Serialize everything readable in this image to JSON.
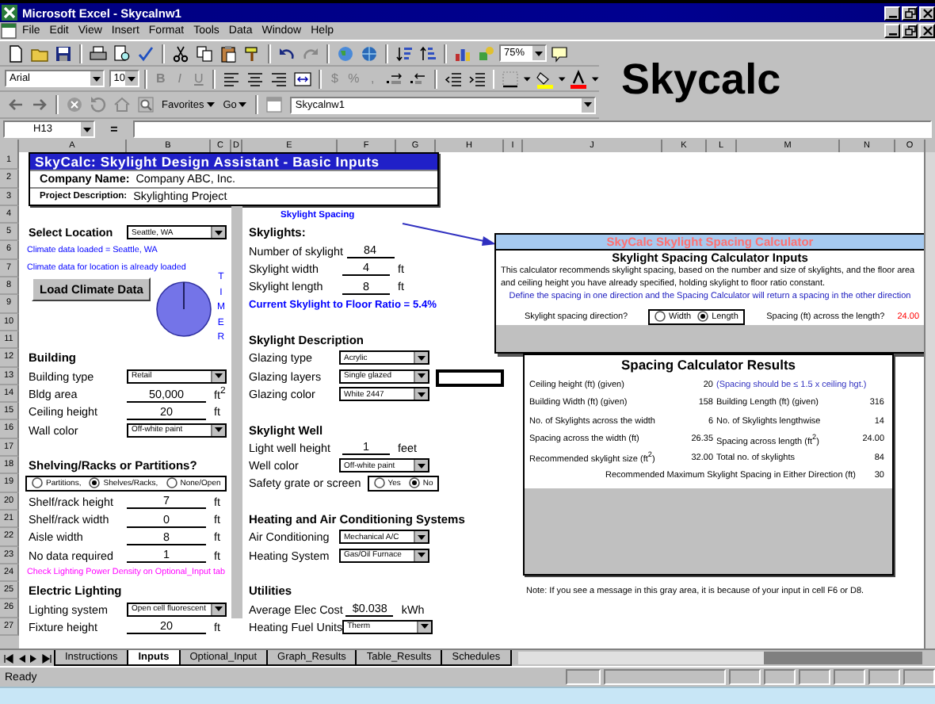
{
  "window": {
    "title": "Microsoft Excel - Skycalnw1"
  },
  "menu": [
    "File",
    "Edit",
    "View",
    "Insert",
    "Format",
    "Tools",
    "Data",
    "Window",
    "Help"
  ],
  "toolbar": {
    "zoom": "75%"
  },
  "formatting": {
    "font": "Arial",
    "size": "10",
    "styles": [
      "B",
      "I",
      "U"
    ],
    "number_formats": [
      "$",
      "%",
      ","
    ]
  },
  "web_toolbar": {
    "favorites": "Favorites",
    "go": "Go",
    "address": "Skycalnw1"
  },
  "banner": "Skycalc",
  "formula_bar": {
    "name_box": "H13",
    "equals": "="
  },
  "columns": [
    "A",
    "B",
    "C",
    "D",
    "E",
    "F",
    "G",
    "H",
    "I",
    "J",
    "K",
    "L",
    "M",
    "N",
    "O"
  ],
  "rows": [
    "1",
    "2",
    "3",
    "4",
    "5",
    "6",
    "7",
    "8",
    "9",
    "10",
    "11",
    "12",
    "13",
    "14",
    "15",
    "16",
    "17",
    "18",
    "19",
    "20",
    "21",
    "22",
    "23",
    "24",
    "25",
    "26",
    "27"
  ],
  "title_block": {
    "title": "SkyCalc: Skylight Design Assistant - Basic Inputs",
    "company_label": "Company Name:",
    "company": "Company ABC, Inc.",
    "project_label": "Project Description:",
    "project": "Skylighting Project"
  },
  "left_items": [
    {
      "kind": "blank"
    },
    {
      "kind": "selector",
      "label": "Select Location",
      "value": "Seattle, WA"
    },
    {
      "kind": "note",
      "text": "Climate data loaded = Seattle, WA",
      "color": "#0000ff"
    },
    {
      "kind": "note",
      "text": "Climate data for location is already loaded",
      "color": "#0000ff"
    },
    {
      "kind": "button",
      "label": "Load Climate Data"
    },
    {
      "kind": "blank"
    },
    {
      "kind": "blank"
    },
    {
      "kind": "heading",
      "label": "Building"
    },
    {
      "kind": "dropdown",
      "label": "Building type",
      "value": "Retail"
    },
    {
      "kind": "input",
      "label": "Bldg area",
      "value": "50,000",
      "unit": "ft$^{2}$"
    },
    {
      "kind": "input",
      "label": "Ceiling height",
      "value": "20",
      "unit": "ft"
    },
    {
      "kind": "dropdown",
      "label": "Wall color",
      "value": "Off-white paint"
    },
    {
      "kind": "blank"
    },
    {
      "kind": "heading",
      "label": "Shelving/Racks or Partitions?"
    },
    {
      "kind": "radio",
      "options": [
        {
          "label": "Partitions,",
          "selected": false
        },
        {
          "label": "Shelves/Racks,",
          "selected": true
        },
        {
          "label": "None/Open",
          "selected": false
        }
      ]
    },
    {
      "kind": "input",
      "label": "Shelf/rack height",
      "value": "7",
      "unit": "ft"
    },
    {
      "kind": "input",
      "label": "Shelf/rack width",
      "value": "0",
      "unit": "ft"
    },
    {
      "kind": "input",
      "label": "Aisle width",
      "value": "8",
      "unit": "ft"
    },
    {
      "kind": "input",
      "label": "No data required",
      "value": "1",
      "unit": "ft"
    },
    {
      "kind": "note",
      "text": "Check Lighting Power Density on Optional_Input tab",
      "color": "#ff00ff"
    },
    {
      "kind": "heading",
      "label": "Electric Lighting"
    },
    {
      "kind": "dropdown",
      "label": "Lighting system",
      "value": "Open cell fluorescent"
    },
    {
      "kind": "input",
      "label": "Fixture height",
      "value": "20",
      "unit": "ft"
    }
  ],
  "timer": {
    "label": "TIMER"
  },
  "middle_items": [
    {
      "kind": "caption",
      "text": "Skylight Spacing",
      "color": "#0000ff"
    },
    {
      "kind": "heading",
      "label": "Skylights:"
    },
    {
      "kind": "input",
      "label": "Number of skylight",
      "value": "84"
    },
    {
      "kind": "input",
      "label": "Skylight width",
      "value": "4",
      "unit": "ft"
    },
    {
      "kind": "input",
      "label": "Skylight length",
      "value": "8",
      "unit": "ft"
    },
    {
      "kind": "highlight",
      "text": "Current Skylight to Floor Ratio = 5.4%",
      "color": "#0000ff"
    },
    {
      "kind": "blank"
    },
    {
      "kind": "heading",
      "label": "Skylight Description"
    },
    {
      "kind": "dropdown",
      "label": "Glazing type",
      "value": "Acrylic"
    },
    {
      "kind": "dropdown",
      "label": "Glazing layers",
      "value": "Single glazed"
    },
    {
      "kind": "dropdown",
      "label": "Glazing color",
      "value": "White 2447"
    },
    {
      "kind": "blank"
    },
    {
      "kind": "heading",
      "label": "Skylight Well"
    },
    {
      "kind": "input",
      "label": "Light well height",
      "value": "1",
      "unit": "feet"
    },
    {
      "kind": "dropdown",
      "label": "Well color",
      "value": "Off-white paint"
    },
    {
      "kind": "radio",
      "label": "Safety grate or screen",
      "options": [
        {
          "label": "Yes",
          "selected": false
        },
        {
          "label": "No",
          "selected": true
        }
      ]
    },
    {
      "kind": "blank"
    },
    {
      "kind": "heading",
      "label": "Heating and Air Conditioning Systems"
    },
    {
      "kind": "dropdown",
      "label": "Air Conditioning",
      "value": "Mechanical A/C"
    },
    {
      "kind": "dropdown",
      "label": "Heating System",
      "value": "Gas/Oil Furnace"
    },
    {
      "kind": "blank"
    },
    {
      "kind": "heading",
      "label": "Utilities"
    },
    {
      "kind": "input",
      "label": "Average Elec Cost",
      "value": "$0.038",
      "unit": "kWh"
    },
    {
      "kind": "dropdown",
      "label": "Heating Fuel Units",
      "value": "Therm"
    }
  ],
  "spacing_calculator": {
    "header": "SkyCalc Skylight Spacing Calculator",
    "title": "Skylight Spacing Calculator Inputs",
    "description": "This calculator recommends skylight spacing, based on the number and size of skylights, and the floor area and ceiling height you have already specified, holding skylight to floor ratio constant.",
    "instruction": "Define the spacing in one direction and the Spacing Calculator will return a spacing in the other direction",
    "direction_label": "Skylight spacing direction?",
    "options": [
      {
        "label": "Width",
        "selected": false
      },
      {
        "label": "Length",
        "selected": true
      }
    ],
    "answer_label": "Spacing (ft) across the length?",
    "answer": "24.00"
  },
  "results": {
    "title": "Spacing Calculator Results",
    "rows": [
      {
        "kind": "hint",
        "label": "Ceiling height (ft) (given)",
        "value": "20",
        "note": "(Spacing should be ≤ 1.5 x ceiling hgt.)"
      },
      {
        "kind": "pair",
        "label": "Building Width (ft) (given)",
        "value": "158",
        "label_2": "Building Length (ft) (given)",
        "value_2": "316"
      },
      {
        "kind": "pair",
        "label": "No. of Skylights across the width",
        "value": "6",
        "label_2": "No. of Skylights lengthwise",
        "value_2": "14"
      },
      {
        "kind": "pair",
        "label": "Spacing across the width (ft)",
        "value": "26.35",
        "label_2": "Spacing across length (ft$^{2}$)",
        "value_2": "24.00"
      },
      {
        "kind": "pair",
        "label": "Recommended skylight size (ft$^{2}$)",
        "value": "32.00",
        "label_2": "Total no. of skylights",
        "value_2": "84"
      },
      {
        "kind": "summary",
        "label": "Recommended Maximum Skylight Spacing in Either Direction (ft)",
        "value": "30"
      }
    ]
  },
  "note": "Note: If you see a message in this gray area, it is because of your input in cell F6 or D8.",
  "sheet_tabs": [
    {
      "label": "Instructions",
      "selected": false
    },
    {
      "label": "Inputs",
      "selected": true
    },
    {
      "label": "Optional_Input",
      "selected": false
    },
    {
      "label": "Graph_Results",
      "selected": false
    },
    {
      "label": "Table_Results",
      "selected": false
    },
    {
      "label": "Schedules",
      "selected": false
    }
  ],
  "status_bar": {
    "text": "Ready"
  }
}
